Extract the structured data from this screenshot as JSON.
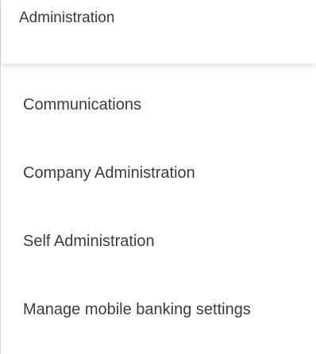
{
  "header": {
    "title": "Administration"
  },
  "menu": {
    "items": [
      {
        "label": "Communications"
      },
      {
        "label": "Company Administration"
      },
      {
        "label": "Self Administration"
      },
      {
        "label": "Manage mobile banking settings"
      }
    ]
  }
}
